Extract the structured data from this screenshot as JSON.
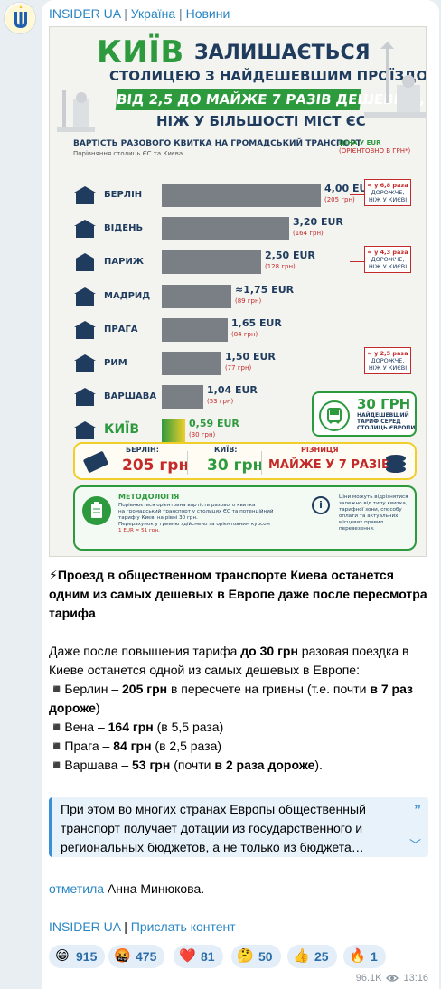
{
  "channel": {
    "name": "INSIDER UA",
    "sep": " | ",
    "category1": "Україна",
    "category2": "Новини"
  },
  "infographic": {
    "title_word": "КИЇВ",
    "title_rest": "ЗАЛИШАЄТЬСЯ",
    "subtitle1": "СТОЛИЦЕЮ З НАЙДЕШЕВШИМ ПРОЇЗДОМ:",
    "highlight": "ВІД 2,5 ДО МАЙЖЕ 7 РАЗІВ ДЕШЕВШЕ,",
    "subtitle2": "НІЖ У БІЛЬШОСТІ МІСТ ЄС",
    "section_title": "ВАРТІСТЬ РАЗОВОГО КВИТКА НА ГРОМАДСЬКИЙ ТРАНСПОРТ",
    "section_sub": "Порівняння столиць ЄС та Києва",
    "price_head1": "ЦІНА У EUR",
    "price_head2": "(ОРІЄНТОВНО В ГРН*)",
    "rows": [
      {
        "city": "БЕРЛІН",
        "eur": "4,00 EUR",
        "uah": "(205 грн)",
        "value": 4.0,
        "icon": "brandenburg-gate-icon"
      },
      {
        "city": "ВІДЕНЬ",
        "eur": "3,20 EUR",
        "uah": "(164 грн)",
        "value": 3.2,
        "icon": "ferris-wheel-icon"
      },
      {
        "city": "ПАРИЖ",
        "eur": "2,50 EUR",
        "uah": "(128 грн)",
        "value": 2.5,
        "icon": "eiffel-tower-icon"
      },
      {
        "city": "МАДРИД",
        "eur": "≈1,75 EUR",
        "uah": "(89 грн)",
        "value": 1.75,
        "icon": "alcala-gate-icon"
      },
      {
        "city": "ПРАГА",
        "eur": "1,65 EUR",
        "uah": "(84 грн)",
        "value": 1.65,
        "icon": "prague-castle-icon"
      },
      {
        "city": "РИМ",
        "eur": "1,50 EUR",
        "uah": "(77 грн)",
        "value": 1.5,
        "icon": "colosseum-icon"
      },
      {
        "city": "ВАРШАВА",
        "eur": "1,04 EUR",
        "uah": "(53 грн)",
        "value": 1.04,
        "icon": "palace-of-culture-icon"
      },
      {
        "city": "КИЇВ",
        "eur": "0,59 EUR",
        "uah": "(30 грн)",
        "value": 0.59,
        "icon": "motherland-monument-icon"
      }
    ],
    "notes": [
      {
        "a": "≈ у 6,8 раза",
        "b": "ДОРОЖЧЕ,",
        "c": "НІЖ У КИЄВІ"
      },
      {
        "a": "≈ у 4,3 раза",
        "b": "ДОРОЖЧЕ,",
        "c": "НІЖ У КИЄВІ"
      },
      {
        "a": "≈ у 2,5 раза",
        "b": "ДОРОЖЧЕ,",
        "c": "НІЖ У КИЄВІ"
      }
    ],
    "kyiv_box": {
      "num": "30 ГРН",
      "l1": "НАЙДЕШЕВШИЙ",
      "l2": "ТАРИФ СЕРЕД",
      "l3": "СТОЛИЦЬ ЄВРОПИ"
    },
    "compare": {
      "berlin_label": "БЕРЛІН:",
      "berlin_value": "205 грн",
      "kyiv_label": "КИЇВ:",
      "kyiv_value": "30 грн",
      "diff_label": "РІЗНИЦЯ",
      "diff_value": "МАЙЖЕ У 7 РАЗІВ!"
    },
    "method": {
      "title": "МЕТОДОЛОГІЯ",
      "l1": "Порівнюється орієнтовна вартість разового квитка",
      "l2": "на громадський транспорт у столицях ЄС та потенційний",
      "l3": "тариф у Києві на рівні 30 грн.",
      "l4": "Перерахунок у гривню здійснено за орієнтовним курсом",
      "l5": "1 EUR = 51 грн.",
      "r1": "Ціни можуть відрізнятися",
      "r2": "залежно від типу квитка,",
      "r3": "тарифної зони, способу",
      "r4": "оплати та актуальних",
      "r5": "місцевих правил",
      "r6": "перевезення."
    }
  },
  "post": {
    "headline_emoji": "⚡",
    "headline": "Проезд в общественном транспорте Киева останется одним из самых дешевых в Европе даже после пересмотра тарифа",
    "p1_a": "Даже после повышения тарифа ",
    "p1_b": "до 30 грн",
    "p1_c": " разовая поездка в Киеве останется одной из самых дешевых в Европе:",
    "b1_a": "◾️Берлин – ",
    "b1_b": "205 грн",
    "b1_c": " в пересчете на гривны (т.е. почти ",
    "b1_d": "в 7 раз дороже",
    "b1_e": ")",
    "b2_a": "◾️Вена – ",
    "b2_b": "164 грн",
    "b2_c": " (в 5,5 раза)",
    "b3_a": "◾️Прага – ",
    "b3_b": "84 грн",
    "b3_c": " (в 2,5 раза)",
    "b4_a": "◾️Варшава – ",
    "b4_b": "53 грн",
    "b4_c": " (почти ",
    "b4_d": "в 2 раза дороже",
    "b4_e": ")."
  },
  "quote": {
    "text": "При этом во многих странах Европы общественный транспорт получает дотации из государственного и региональных бюджетов, а не только из бюджета…"
  },
  "author": {
    "link": "отметила",
    "name": " Анна Минюкова."
  },
  "links": {
    "channel": "INSIDER UA",
    "sep": " | ",
    "submit": "Прислать контент"
  },
  "reactions": [
    {
      "emoji": "😁",
      "count": "915",
      "icon": "grin-icon"
    },
    {
      "emoji": "🤬",
      "count": "475",
      "icon": "angry-icon"
    },
    {
      "emoji": "❤️",
      "count": "81",
      "icon": "heart-icon"
    },
    {
      "emoji": "🤔",
      "count": "50",
      "icon": "thinking-icon"
    },
    {
      "emoji": "👍",
      "count": "25",
      "icon": "thumbs-up-icon"
    },
    {
      "emoji": "🔥",
      "count": "1",
      "icon": "fire-icon"
    }
  ],
  "meta": {
    "views": "96.1K",
    "time": "13:16"
  },
  "colors": {
    "accent": "#2a86c4",
    "green": "#2d9a3e",
    "red": "#c32a2a",
    "navy": "#1f3b5e",
    "reaction_bg": "#e4eef8"
  }
}
